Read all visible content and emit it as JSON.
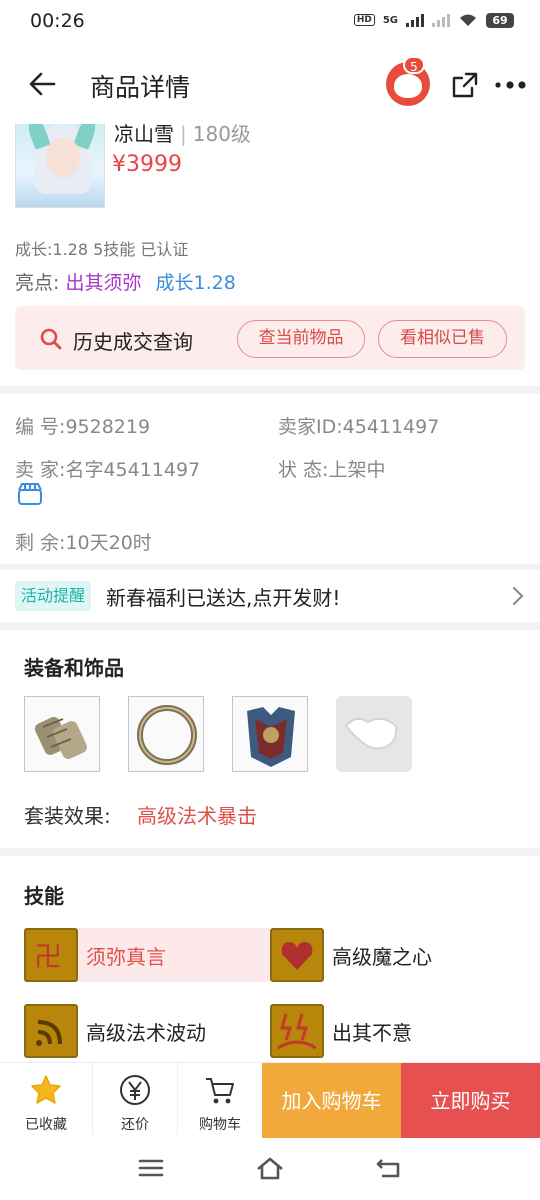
{
  "status_bar": {
    "time": "00:26",
    "network": "5G",
    "hd": "HD",
    "battery": "69"
  },
  "header": {
    "title": "商品详情",
    "cart_badge": "5"
  },
  "product": {
    "name": "凉山雪",
    "level": "180级",
    "price": "¥3999",
    "growth_info": "成长:1.28 5技能 已认证",
    "highlight_label": "亮点:",
    "highlights": [
      "出其须弥",
      "成长1.28"
    ]
  },
  "history": {
    "label": "历史成交查询",
    "btn_current": "查当前物品",
    "btn_similar": "看相似已售"
  },
  "info": {
    "id_label": "编  号:",
    "id_value": "9528219",
    "seller_id_label": "卖家ID:",
    "seller_id_value": "45411497",
    "seller_label": "卖  家:",
    "seller_value": "名字45411497",
    "status_label": "状  态:",
    "status_value": "上架中",
    "remain_label": "剩  余:",
    "remain_value": "10天20时"
  },
  "activity": {
    "tag": "活动提醒",
    "text": "新春福利已送达,点开发财!"
  },
  "equipment": {
    "title": "装备和饰品",
    "items": [
      "bracer-icon",
      "ring-icon",
      "armor-icon",
      "empty-slot-icon"
    ],
    "set_label": "套装效果:",
    "set_value": "高级法术暴击"
  },
  "skills": {
    "title": "技能",
    "items": [
      {
        "label": "须弥真言",
        "icon": "sumeru-mantra-icon",
        "selected": true
      },
      {
        "label": "高级魔之心",
        "icon": "demon-heart-icon",
        "selected": false
      },
      {
        "label": "高级法术波动",
        "icon": "spell-wave-icon",
        "selected": false
      },
      {
        "label": "出其不意",
        "icon": "surprise-icon",
        "selected": false
      }
    ]
  },
  "bottom_bar": {
    "favorite": "已收藏",
    "bargain": "还价",
    "cart": "购物车",
    "add_to_cart": "加入购物车",
    "buy_now": "立即购买"
  },
  "colors": {
    "accent_red": "#e65050",
    "accent_orange": "#f2a93b",
    "price_red": "#e84545"
  }
}
